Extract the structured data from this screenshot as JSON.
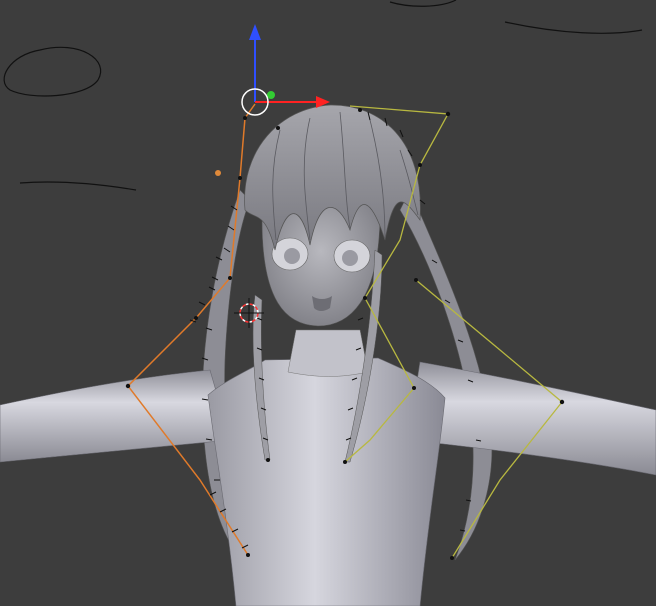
{
  "viewport": {
    "background_color": "#3d3d3d"
  },
  "scene": {
    "subject": "character-mesh",
    "mesh_color": "#c8c8d0",
    "hair_color": "#9a9aa0"
  },
  "curves": {
    "orange_curve_color": "#e07a2a",
    "yellow_curve_color": "#b8b840",
    "control_point_color": "#111111"
  },
  "gizmo": {
    "z_axis_color": "#2f4fff",
    "x_axis_color": "#ff2222",
    "y_handle_color": "#33cc33",
    "center_circle_color": "#ffffff"
  },
  "cursor_3d": {
    "ring_color_a": "#ff3333",
    "ring_color_b": "#ffffff"
  }
}
